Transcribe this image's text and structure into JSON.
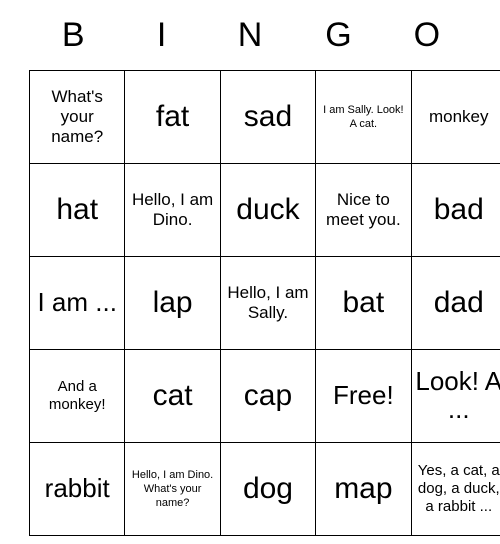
{
  "card": {
    "title_letters": [
      "B",
      "I",
      "N",
      "G",
      "O"
    ],
    "free_space_label": "Free!",
    "colors": {
      "text": "#000000",
      "border": "#000000",
      "background": "#ffffff"
    },
    "grid_size": "5x5",
    "rows": [
      [
        {
          "text": "What's your name?",
          "size": "md"
        },
        {
          "text": "fat",
          "size": "xl"
        },
        {
          "text": "sad",
          "size": "xl"
        },
        {
          "text": "I am Sally. Look! A cat.",
          "size": "xs"
        },
        {
          "text": "monkey",
          "size": "md"
        }
      ],
      [
        {
          "text": "hat",
          "size": "xl"
        },
        {
          "text": "Hello, I am Dino.",
          "size": "md"
        },
        {
          "text": "duck",
          "size": "xl"
        },
        {
          "text": "Nice to meet you.",
          "size": "md"
        },
        {
          "text": "bad",
          "size": "xl"
        }
      ],
      [
        {
          "text": "I am ...",
          "size": "lg"
        },
        {
          "text": "lap",
          "size": "xl"
        },
        {
          "text": "Hello, I am Sally.",
          "size": "md"
        },
        {
          "text": "bat",
          "size": "xl"
        },
        {
          "text": "dad",
          "size": "xl"
        }
      ],
      [
        {
          "text": "And a monkey!",
          "size": "sm"
        },
        {
          "text": "cat",
          "size": "xl"
        },
        {
          "text": "cap",
          "size": "xl"
        },
        {
          "text": "Free!",
          "size": "lg"
        },
        {
          "text": "Look! A ...",
          "size": "lg"
        }
      ],
      [
        {
          "text": "rabbit",
          "size": "lg"
        },
        {
          "text": "Hello, I am Dino. What's your name?",
          "size": "xs"
        },
        {
          "text": "dog",
          "size": "xl"
        },
        {
          "text": "map",
          "size": "xl"
        },
        {
          "text": "Yes, a cat, a dog, a duck, a rabbit ...",
          "size": "sm"
        }
      ]
    ]
  }
}
